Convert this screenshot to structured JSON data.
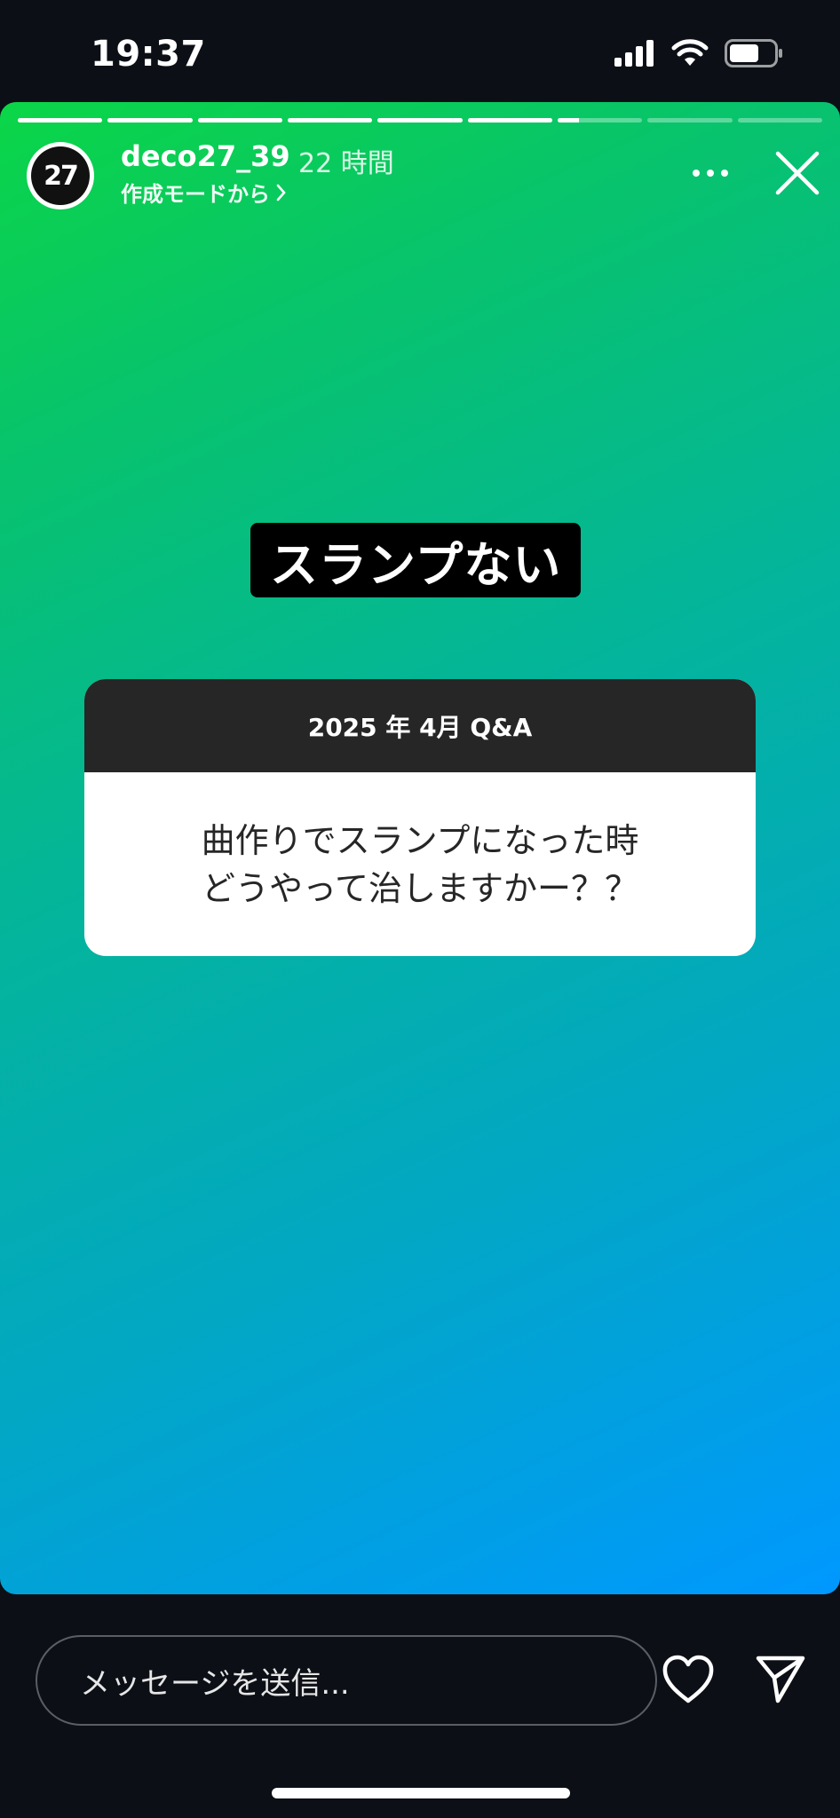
{
  "status_bar": {
    "time": "19:37"
  },
  "story": {
    "username": "deco27_39",
    "time_ago": "22 時間",
    "subtitle": "作成モードから",
    "avatar_label": "27",
    "segments": [
      1,
      1,
      1,
      1,
      1,
      1,
      0.25,
      0,
      0
    ],
    "sticker_text": "スランプない",
    "qa": {
      "header": "2025 年 4月 Q&A",
      "question_line1": "曲作りでスランプになった時",
      "question_line2": "どうやって治しますかー？？"
    }
  },
  "composer": {
    "placeholder": "メッセージを送信..."
  }
}
